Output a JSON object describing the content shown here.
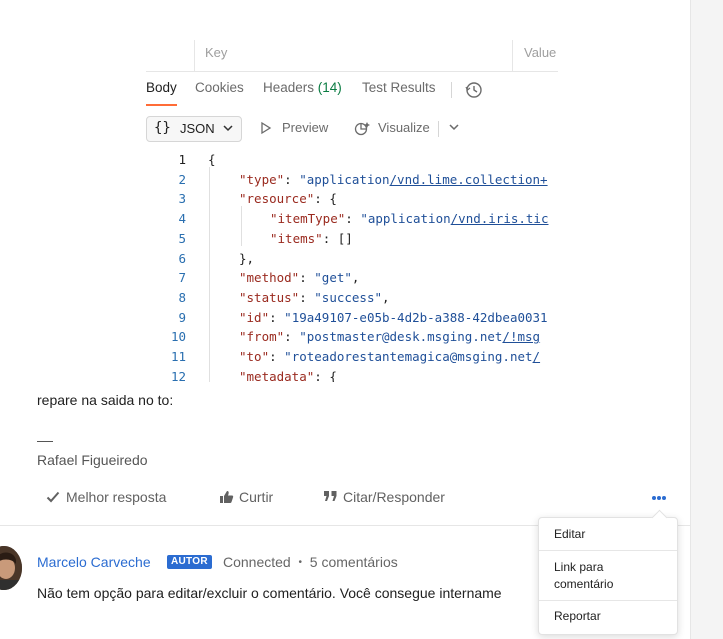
{
  "screenshot": {
    "kv_headers": {
      "key": "Key",
      "value": "Value"
    },
    "tabs": [
      {
        "label": "Body"
      },
      {
        "label": "Cookies"
      },
      {
        "label": "Headers",
        "count": "(14)"
      },
      {
        "label": "Test Results"
      }
    ],
    "toolbar": {
      "format_braces": "{}",
      "format_label": "JSON",
      "preview_label": "Preview",
      "visualize_label": "Visualize"
    },
    "code_lines": [
      {
        "n": "1",
        "text": "{"
      },
      {
        "n": "2",
        "key": "\"type\"",
        "sep": ": ",
        "val_a": "\"application",
        "val_b": "/vnd.lime.collection+",
        "indent": 1
      },
      {
        "n": "3",
        "key": "\"resource\"",
        "sep": ": {",
        "indent": 1
      },
      {
        "n": "4",
        "key": "\"itemType\"",
        "sep": ": ",
        "val_a": "\"application",
        "val_b": "/vnd.iris.tic",
        "indent": 2
      },
      {
        "n": "5",
        "key": "\"items\"",
        "sep": ": []",
        "indent": 2
      },
      {
        "n": "6",
        "text": "},",
        "indent": 1
      },
      {
        "n": "7",
        "key": "\"method\"",
        "sep": ": ",
        "val_a": "\"get\"",
        "tail": ",",
        "indent": 1
      },
      {
        "n": "8",
        "key": "\"status\"",
        "sep": ": ",
        "val_a": "\"success\"",
        "tail": ",",
        "indent": 1
      },
      {
        "n": "9",
        "key": "\"id\"",
        "sep": ": ",
        "val_a": "\"19a49107-e05b-4d2b-a388-42dbea0031",
        "indent": 1
      },
      {
        "n": "10",
        "key": "\"from\"",
        "sep": ": ",
        "val_a": "\"postmaster@desk.msging.net",
        "val_b": "/!msg",
        "indent": 1
      },
      {
        "n": "11",
        "key": "\"to\"",
        "sep": ": ",
        "val_a": "\"roteadorestantemagica@msging.net",
        "val_b": "/",
        "indent": 1
      },
      {
        "n": "12",
        "key": "\"metadata\"",
        "sep": ": {",
        "indent": 1
      }
    ]
  },
  "post": {
    "text": "repare na saida no to:",
    "signature_dash": "—",
    "signature_name": "Rafael Figueiredo",
    "actions": {
      "best_answer": "Melhor resposta",
      "like": "Curtir",
      "quote": "Citar/Responder"
    }
  },
  "reply": {
    "author": "Marcelo Carveche",
    "badge": "AUTOR",
    "status": "Connected",
    "dot": "•",
    "comments": "5 comentários",
    "text": "Não tem opção para editar/excluir o comentário. Você consegue intername"
  },
  "menu": {
    "edit": "Editar",
    "link": "Link para comentário",
    "report": "Reportar"
  }
}
